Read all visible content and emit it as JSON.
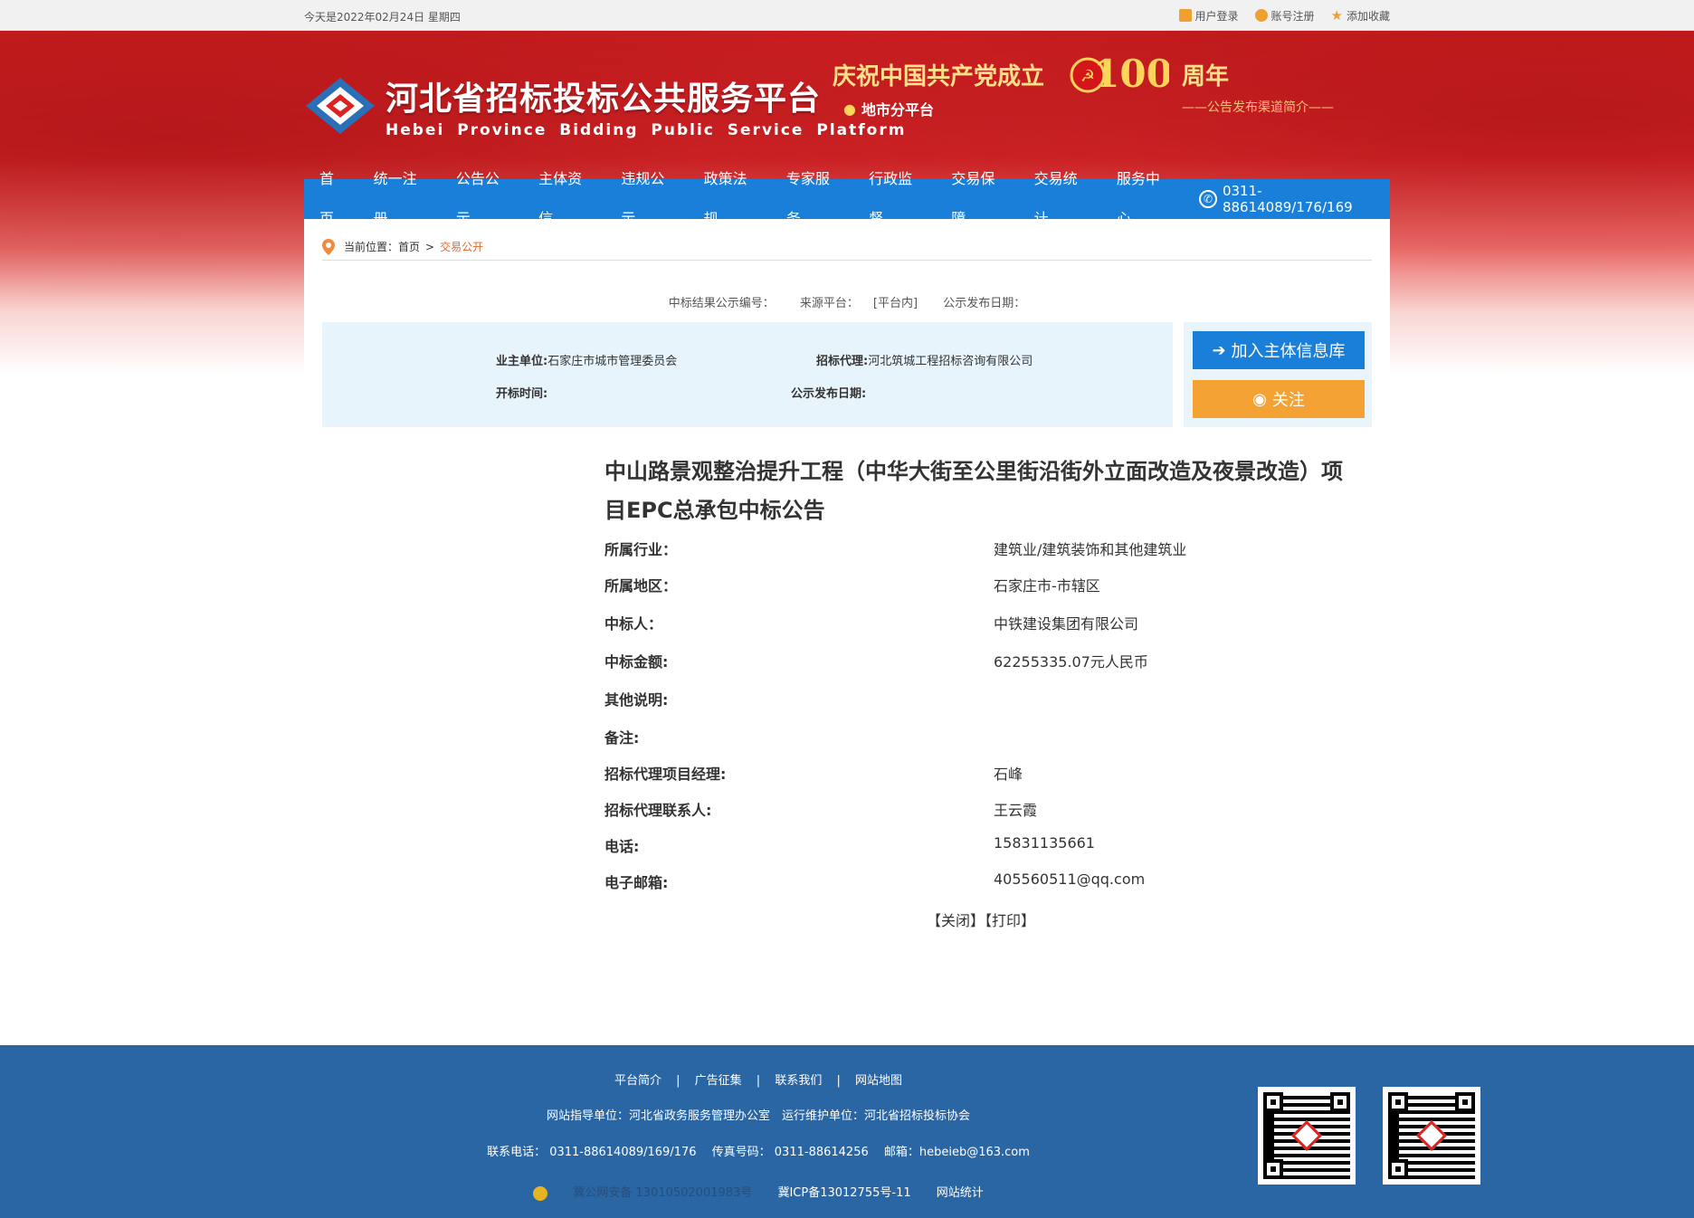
{
  "topbar": {
    "date": "今天是2022年02月24日 星期四",
    "login": "用户登录",
    "register": "账号注册",
    "favorite": "添加收藏"
  },
  "header": {
    "title_cn": "河北省招标投标公共服务平台",
    "title_en": "Hebei Province Bidding Public Service Platform",
    "celebrate_left": "庆祝中国共产党成立",
    "celebrate_num": "100",
    "celebrate_right": "周年",
    "celebrate_sub": "——公告发布渠道简介——",
    "sub_platform": "地市分平台"
  },
  "nav": {
    "items": [
      "首页",
      "统一注册",
      "公告公示",
      "主体资信",
      "违规公示",
      "政策法规",
      "专家服务",
      "行政监督",
      "交易保障",
      "交易统计",
      "服务中心"
    ],
    "phone": "0311-88614089/176/169"
  },
  "breadcrumb": {
    "prefix": "当前位置：",
    "home": "首页",
    "sep": ">",
    "current": "交易公开"
  },
  "meta": {
    "code_label": "中标结果公示编号：",
    "source_label": "来源平台：",
    "source_value": "[平台内]",
    "date_label": "公示发布日期："
  },
  "info": {
    "owner_label": "业主单位:",
    "owner_value": "石家庄市城市管理委员会",
    "agent_label": "招标代理:",
    "agent_value": "河北筑城工程招标咨询有限公司",
    "open_label": "开标时间:",
    "publish_label": "公示发布日期:"
  },
  "actions": {
    "add_label": "加入主体信息库",
    "follow_label": "关注"
  },
  "article": {
    "title": "中山路景观整治提升工程（中华大街至公里街沿街外立面改造及夜景改造）项目EPC总承包中标公告",
    "fields": [
      {
        "label": "所属行业：",
        "value": "建筑业/建筑装饰和其他建筑业"
      },
      {
        "label": "所属地区：",
        "value": "石家庄市-市辖区"
      },
      {
        "label": "中标人：",
        "value": "中铁建设集团有限公司"
      },
      {
        "label": "中标金额:",
        "value": "62255335.07元人民币"
      },
      {
        "label": "其他说明:",
        "value": ""
      },
      {
        "label": "备注:",
        "value": ""
      },
      {
        "label": "招标代理项目经理:",
        "value": "石峰"
      },
      {
        "label": "招标代理联系人:",
        "value": "王云霞"
      },
      {
        "label": "电话:",
        "value": "15831135661"
      },
      {
        "label": "电子邮箱:",
        "value": "405560511@qq.com"
      }
    ],
    "close_label": "【关闭】",
    "print_label": "【打印】"
  },
  "footer": {
    "links": [
      "平台简介",
      "广告征集",
      "联系我们",
      "网站地图"
    ],
    "guide": "网站指导单位：河北省政务服务管理办公室　运行维护单位：河北省招标投标协会",
    "contact": "联系电话： 0311-88614089/169/176　 传真号码： 0311-88614256　 邮箱：hebeieb@163.com",
    "police": "冀公网安备 13010502001983号",
    "icp": "冀ICP备13012755号-11",
    "stats": "网站统计"
  }
}
